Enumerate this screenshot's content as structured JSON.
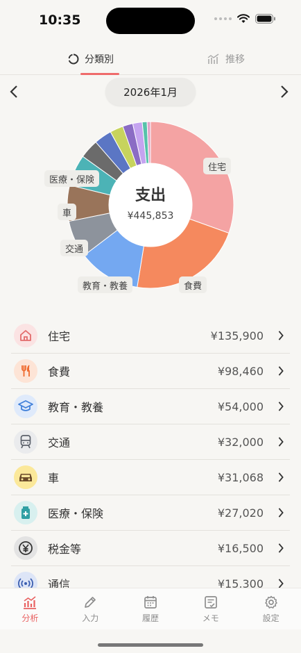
{
  "status": {
    "time": "10:35"
  },
  "tabs": [
    {
      "label": "分類別",
      "icon": "donut-icon",
      "active": true
    },
    {
      "label": "推移",
      "icon": "trend-chart-icon",
      "active": false
    }
  ],
  "month": {
    "label": "2026年1月"
  },
  "summary": {
    "title": "支出",
    "total": "¥445,853"
  },
  "chart_data": {
    "type": "pie",
    "variant": "donut",
    "title": "支出",
    "total_value": 445853,
    "slices": [
      {
        "label": "住宅",
        "value": 135900,
        "color": "#f4a3a3"
      },
      {
        "label": "食費",
        "value": 98460,
        "color": "#f5895e"
      },
      {
        "label": "教育・教養",
        "value": 54000,
        "color": "#74a8f1"
      },
      {
        "label": "交通",
        "value": 32000,
        "color": "#8d939c"
      },
      {
        "label": "車",
        "value": 31068,
        "color": "#99745a"
      },
      {
        "label": "医療・保険",
        "value": 27020,
        "color": "#4cb3b6"
      },
      {
        "label": "税金等",
        "value": 16500,
        "color": "#6b6b6b"
      },
      {
        "label": "通信",
        "value": 15300,
        "color": "#5b76c4"
      },
      {
        "label": "",
        "value": 11500,
        "color": "#c7d35d"
      },
      {
        "label": "",
        "value": 8800,
        "color": "#8b6cc4"
      },
      {
        "label": "",
        "value": 8200,
        "color": "#c5a4f0"
      },
      {
        "label": "",
        "value": 4205,
        "color": "#56c2aa"
      },
      {
        "label": "",
        "value": 2900,
        "color": "#e3a3c8"
      }
    ]
  },
  "categories": [
    {
      "label": "住宅",
      "amount": "¥135,900",
      "icon": "house-icon",
      "bg": "#fbe3e3",
      "fg": "#e26b6b"
    },
    {
      "label": "食費",
      "amount": "¥98,460",
      "icon": "fork-knife-icon",
      "bg": "#fde4d6",
      "fg": "#ef6a2e"
    },
    {
      "label": "教育・教養",
      "amount": "¥54,000",
      "icon": "graduation-cap-icon",
      "bg": "#dfeafb",
      "fg": "#3f7fd9"
    },
    {
      "label": "交通",
      "amount": "¥32,000",
      "icon": "train-icon",
      "bg": "#eaebed",
      "fg": "#5c626b"
    },
    {
      "label": "車",
      "amount": "¥31,068",
      "icon": "car-icon",
      "bg": "#fbe89a",
      "fg": "#6b4b2a"
    },
    {
      "label": "医療・保険",
      "amount": "¥27,020",
      "icon": "medicine-icon",
      "bg": "#d8f0ef",
      "fg": "#2f9fa3"
    },
    {
      "label": "税金等",
      "amount": "¥16,500",
      "icon": "yen-coin-icon",
      "bg": "#e3e3e3",
      "fg": "#333333"
    },
    {
      "label": "通信",
      "amount": "¥15,300",
      "icon": "signal-icon",
      "bg": "#dde5f7",
      "fg": "#3c5fb0"
    }
  ],
  "bottom_nav": [
    {
      "label": "分析",
      "icon": "analytics-icon",
      "active": true
    },
    {
      "label": "入力",
      "icon": "pencil-icon",
      "active": false
    },
    {
      "label": "履歴",
      "icon": "calendar-icon",
      "active": false
    },
    {
      "label": "メモ",
      "icon": "memo-icon",
      "active": false
    },
    {
      "label": "設定",
      "icon": "gear-icon",
      "active": false
    }
  ]
}
